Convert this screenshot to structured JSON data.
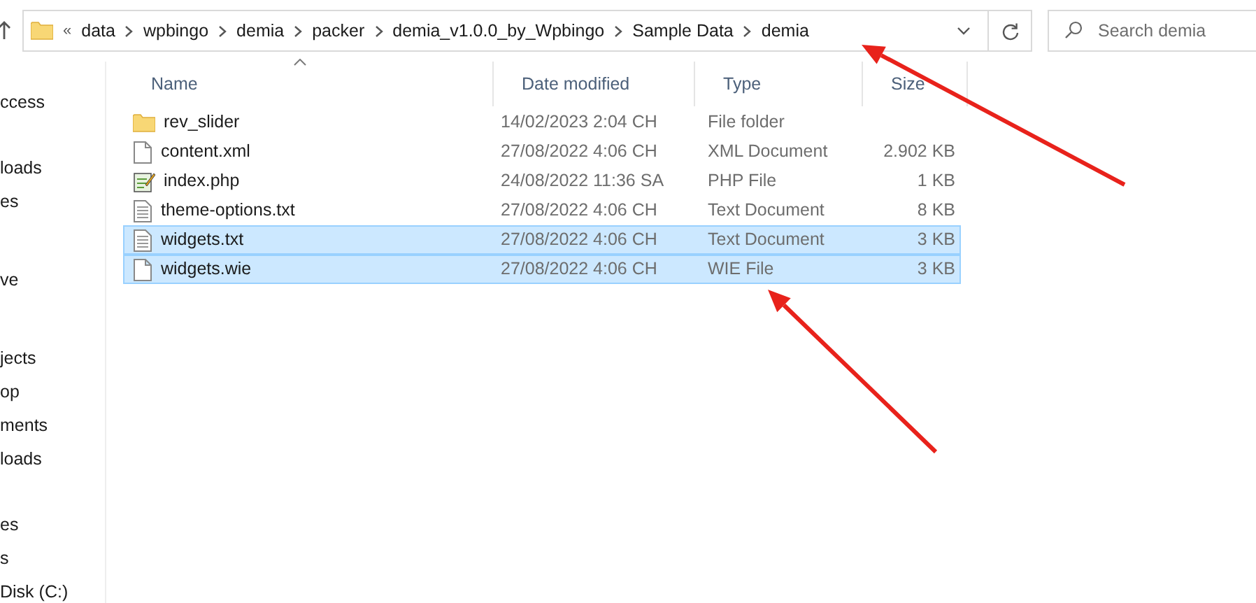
{
  "address_bar": {
    "overflow": "«",
    "crumbs": [
      "data",
      "wpbingo",
      "demia",
      "packer",
      "demia_v1.0.0_by_Wpbingo",
      "Sample Data",
      "demia"
    ]
  },
  "search": {
    "placeholder": "Search demia"
  },
  "sidebar": {
    "groups": [
      {
        "items": [
          "ccess"
        ]
      },
      {
        "items": [
          "loads",
          "es"
        ]
      },
      {
        "items": [
          "ve"
        ]
      },
      {
        "items": [
          "jects",
          "op",
          "ments",
          "loads"
        ]
      },
      {
        "items": [
          "es",
          "s",
          "Disk (C:)"
        ]
      }
    ]
  },
  "table": {
    "columns": [
      {
        "label": "Name",
        "sorted": true
      },
      {
        "label": "Date modified",
        "sorted": false
      },
      {
        "label": "Type",
        "sorted": false
      },
      {
        "label": "Size",
        "sorted": false
      }
    ],
    "rows": [
      {
        "kind": "folder",
        "name": "rev_slider",
        "date": "14/02/2023 2:04 CH",
        "type": "File folder",
        "selected": false
      },
      {
        "kind": "blank",
        "name": "content.xml",
        "date": "27/08/2022 4:06 CH",
        "type": "XML Document",
        "size": "2.902 KB",
        "selected": false
      },
      {
        "kind": "php",
        "name": "index.php",
        "date": "24/08/2022 11:36 SA",
        "type": "PHP File",
        "size": "1 KB",
        "selected": false
      },
      {
        "kind": "text",
        "name": "theme-options.txt",
        "date": "27/08/2022 4:06 CH",
        "type": "Text Document",
        "size": "8 KB",
        "selected": false
      },
      {
        "kind": "text",
        "name": "widgets.txt",
        "date": "27/08/2022 4:06 CH",
        "type": "Text Document",
        "size": "3 KB",
        "selected": true
      },
      {
        "kind": "blank",
        "name": "widgets.wie",
        "date": "27/08/2022 4:06 CH",
        "type": "WIE File",
        "size": "3 KB",
        "selected": true
      }
    ]
  },
  "annotations": [
    {
      "kind": "arrow",
      "color": "#e8221b"
    },
    {
      "kind": "arrow",
      "color": "#e8221b"
    }
  ]
}
